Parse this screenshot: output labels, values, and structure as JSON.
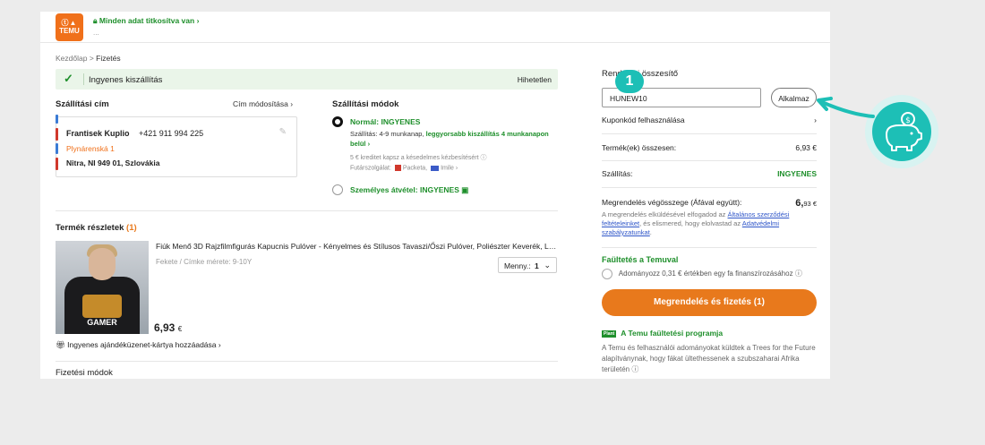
{
  "header": {
    "logo_text": "TEMU",
    "secure_text": "Minden adat titkosítva van",
    "secure_sub": "..."
  },
  "breadcrumb": {
    "home": "Kezdőlap",
    "separator": ">",
    "current": "Fizetés"
  },
  "banner": {
    "text": "Ingyenes kiszállítás",
    "right": "Hihetetlen"
  },
  "address": {
    "title": "Szállítási cím",
    "edit_label": "Cím módosítása",
    "name": "Frantisek Kuplio",
    "phone": "+421 911 994 225",
    "street": "Plynárenská 1",
    "city": "Nitra, NI 949 01, Szlovákia"
  },
  "shipping": {
    "title": "Szállítási módok",
    "option1_label": "Normál: INGYENES",
    "option1_line_a": "Szállítás: 4-9 munkanap, ",
    "option1_line_b": "leggyorsabb kiszállítás 4 munkanapon",
    "option1_line_c": "belül",
    "option1_credit": "5 € kreditet kapsz a késedelmes kézbesítésért",
    "couriers_label": "Futárszolgálat:",
    "courier1": "Packeta,",
    "courier2": "Imile",
    "option2_label": "Személyes átvétel: INGYENES"
  },
  "product": {
    "section_title": "Termék részletek",
    "count": "(1)",
    "title": "Fiúk Menő 3D Rajzfilmfigurás Kapucnis Pulóver - Kényelmes és Stílusos Tavaszi/Őszi Pulóver, Poliészter Keverék, La...",
    "variant": "Fekete / Címke mérete: 9-10Y",
    "qty_label": "Menny.:",
    "qty_value": "1",
    "price": "6,93",
    "currency": "€",
    "image_text": "GAMER",
    "gift_label": "Ingyenes ajándéküzenet-kártya hozzáadása"
  },
  "payment": {
    "title": "Fizetési módok"
  },
  "summary": {
    "title": "Rendelési összesítő",
    "coupon_value": "HUNEW10",
    "apply_label": "Alkalmaz",
    "step_badge": "1",
    "coupon_use_label": "Kuponkód felhasználása",
    "items_label": "Termék(ek) összesen:",
    "items_value": "6,93 €",
    "shipping_label": "Szállítás:",
    "shipping_value": "INGYENES",
    "total_label": "Megrendelés végösszege (Áfával együtt):",
    "total_value": "6,",
    "total_cents": "93 €",
    "terms_a": "A megrendelés elküldésével elfogadod az ",
    "terms_link1": "Általános szerződési feltételeinket",
    "terms_b": ", és elismered, hogy elolvastad az ",
    "terms_link2": "Adatvédelmi szabályzatunkat",
    "terms_c": ".",
    "tree_title": "Faültetés a Temuval",
    "donate_text": "Adományozz 0,31 € értékben egy fa finanszírozásához",
    "order_button": "Megrendelés és fizetés (1)",
    "program_badge": "Plant",
    "program_title": "A Temu faültetési programja",
    "program_text": "A Temu és felhasználói adományokat küldtek a Trees for the Future alapítványnak, hogy fákat ültethessenek a szubszaharai Afrika területén"
  },
  "colors": {
    "brand": "#e8791c",
    "green": "#1e8f2b",
    "teal": "#1dbfb6"
  }
}
